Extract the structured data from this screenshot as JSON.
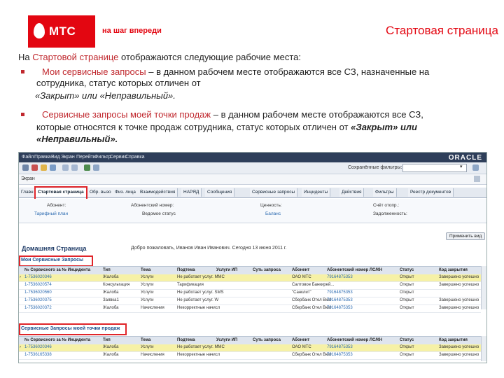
{
  "header": {
    "brand": "МТС",
    "slogan": "на шаг впереди",
    "page_title": "Стартовая страница",
    "brand_color": "#e30611"
  },
  "intro": {
    "line1_prefix": "На ",
    "line1_link": "Стартовой странице",
    "line1_suffix": " отображаются следующие рабочие места:",
    "b1_title": "Мои сервисные запросы",
    "b1_l1": " – в данном рабочем месте отображаются все СЗ, назначенные на",
    "b1_l2": "сотрудника, статус которых отличен от",
    "b1_l3": "«Закрыт» или «Неправильный».",
    "b2_title": "Сервисные запросы моей точки продаж",
    "b2_l1": " – в данном рабочем месте отображаются все СЗ,",
    "b2_l2a": "которые относятся к точке продаж сотрудника, статус которых отличен от ",
    "b2_l2b": "«Закрыт» или",
    "b2_l3": "«Неправильный»."
  },
  "app": {
    "menu": [
      "Файл",
      "Правка",
      "Вид",
      "Экран",
      "Перейти",
      "Фильтр",
      "Сервис",
      "Справка"
    ],
    "oracle": "ORACLE",
    "saved_filters_label": "Сохранённые фильтры:",
    "screen_label": "Экран",
    "tabs": [
      "Главн",
      "Стартовая страница",
      "Обр. вызо",
      "Физ. лица",
      "Взаимодействия",
      "НАРЯД",
      "Сообщения",
      "Сервисные запросы",
      "Инциденты",
      "Действия",
      "Фильтры",
      "Реестр документов"
    ],
    "info": {
      "account_label": "Абонент:",
      "account_number_label": "Абонентский номер:",
      "value_label": "Ценность:",
      "sold_label": "Счёт отопр.:",
      "tariff_label": "Тарифный план",
      "device_label": "Ведомое статус",
      "balance_label": "Баланс",
      "debt_label": "Задолженность:"
    },
    "home_title": "Домашняя Страница",
    "welcome": "Добро пожаловать, Иванов Иван Иванович. Сегодня 13 июня 2011 г.",
    "apply_btn": "Применить вид",
    "section1_title": "Мои Сервисные Запросы",
    "section2_title": "Сервисные Запросы моей точки продаж",
    "columns": [
      "№ Сервисного за № Инцидента",
      "Тип",
      "Тема",
      "Подтема",
      "Услуги ИП",
      "Суть запроса",
      "Абонент",
      "Абонентский номер ЛС/КН",
      "Статус",
      "Код закрытия"
    ],
    "rows1": [
      [
        "1-7536020346",
        "Жалоба",
        "Услуги",
        "Не работает услуг. ММС",
        "",
        "",
        "ОАО МТС",
        "79164875353",
        "Открыт",
        "Завершено успешно"
      ],
      [
        "1-7536020574",
        "Консультация",
        "Услуги",
        "Тарификация",
        "",
        "",
        "Салтовое Банкирей...",
        "",
        "Открыт",
        "Завершено успешно"
      ],
      [
        "1-7536020560",
        "Жалоба",
        "Услуги",
        "Не работает услуг. SMS",
        "",
        "",
        "\"Санклит\"",
        "79164875353",
        "Открыт",
        ""
      ],
      [
        "1-7536020375",
        "Заявка1",
        "Услуги",
        "Не работает услуг. W",
        "",
        "",
        "Сбербанк Отел Вюл",
        "79164875353",
        "Открыт",
        "Завершено успешно"
      ],
      [
        "1-7536020372",
        "Жалоба",
        "Начисления",
        "Некорректные начисл",
        "",
        "",
        "Сбербанк Отел Вюл",
        "79164875353",
        "Открыт",
        "Завершено успешно"
      ]
    ],
    "rows2": [
      [
        "1-7536020346",
        "Жалоба",
        "Услуги",
        "Не работает услуг. ММС",
        "",
        "",
        "ОАО МТС",
        "79164875353",
        "Открыт",
        "Завершено успешно"
      ],
      [
        "1-7536165338",
        "Жалоба",
        "Начисления",
        "Некорректные начисл",
        "",
        "",
        "Сбербанк Отел Вюл",
        "79164875353",
        "Открыт",
        "Завершено успешно"
      ]
    ]
  }
}
